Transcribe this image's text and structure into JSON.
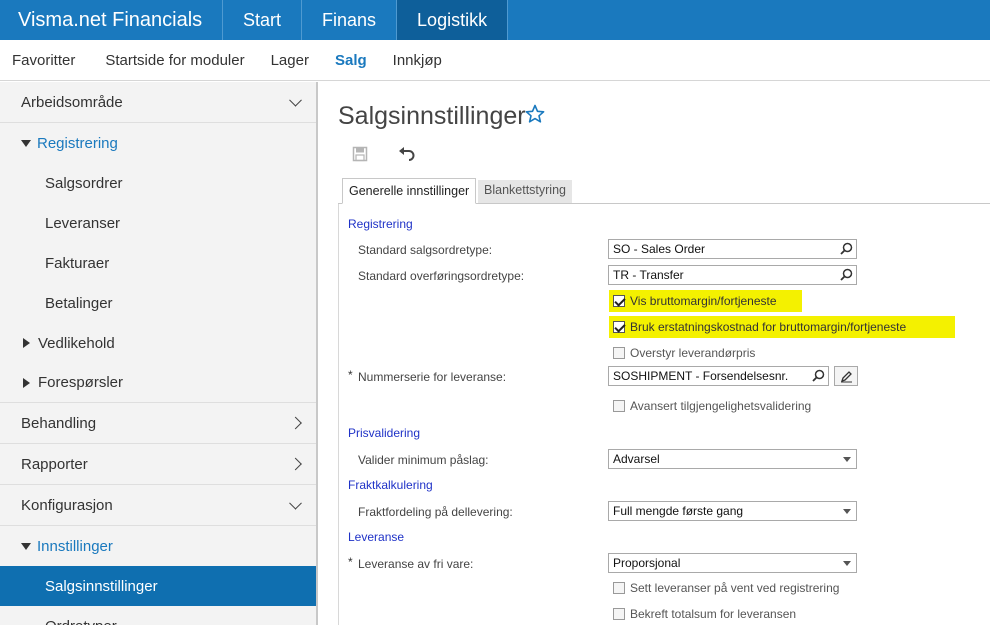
{
  "app": {
    "title": "Visma.net Financials"
  },
  "topnav": [
    "Start",
    "Finans",
    "Logistikk"
  ],
  "modules": [
    "Favoritter",
    "Startside for moduler",
    "Lager",
    "Salg",
    "Innkjøp"
  ],
  "sidebar": {
    "arbeidsomrade": "Arbeidsområde",
    "registrering": "Registrering",
    "salgsordrer": "Salgsordrer",
    "leveranser": "Leveranser",
    "fakturaer": "Fakturaer",
    "betalinger": "Betalinger",
    "vedlikehold": "Vedlikehold",
    "foresporsler": "Forespørsler",
    "behandling": "Behandling",
    "rapporter": "Rapporter",
    "konfigurasjon": "Konfigurasjon",
    "innstillinger": "Innstillinger",
    "salgsinnstillinger": "Salgsinnstillinger",
    "ordretyper": "Ordretyper"
  },
  "page": {
    "title": "Salgsinnstillinger"
  },
  "tabs": {
    "general": "Generelle innstillinger",
    "forms": "Blankettstyring"
  },
  "form": {
    "sec_registrering": "Registrering",
    "lbl_salgsordretype": "Standard salgsordretype:",
    "val_salgsordretype": "SO - Sales Order",
    "lbl_overforingsordretype": "Standard overføringsordretype:",
    "val_overforingsordretype": "TR - Transfer",
    "chk_bruttomargin": "Vis bruttomargin/fortjeneste",
    "chk_erstatningskostnad": "Bruk erstatningskostnad for bruttomargin/fortjeneste",
    "chk_overstyr": "Overstyr leverandørpris",
    "req": "*",
    "lbl_nummerserie": "Nummerserie for leveranse:",
    "val_nummerserie": "SOSHIPMENT - Forsendelsesnr.",
    "chk_avansert": "Avansert tilgjengelighetsvalidering",
    "sec_prisvalidering": "Prisvalidering",
    "lbl_pslag": "Valider minimum påslag:",
    "val_pslag": "Advarsel",
    "sec_frakt": "Fraktkalkulering",
    "lbl_frakt": "Fraktfordeling på dellevering:",
    "val_frakt": "Full mengde første gang",
    "sec_leveranse": "Leveranse",
    "lbl_frivare": "Leveranse av fri vare:",
    "val_frivare": "Proporsjonal",
    "chk_vent": "Sett leveranser på vent ved registrering",
    "chk_totalsum": "Bekreft totalsum for leveransen"
  }
}
